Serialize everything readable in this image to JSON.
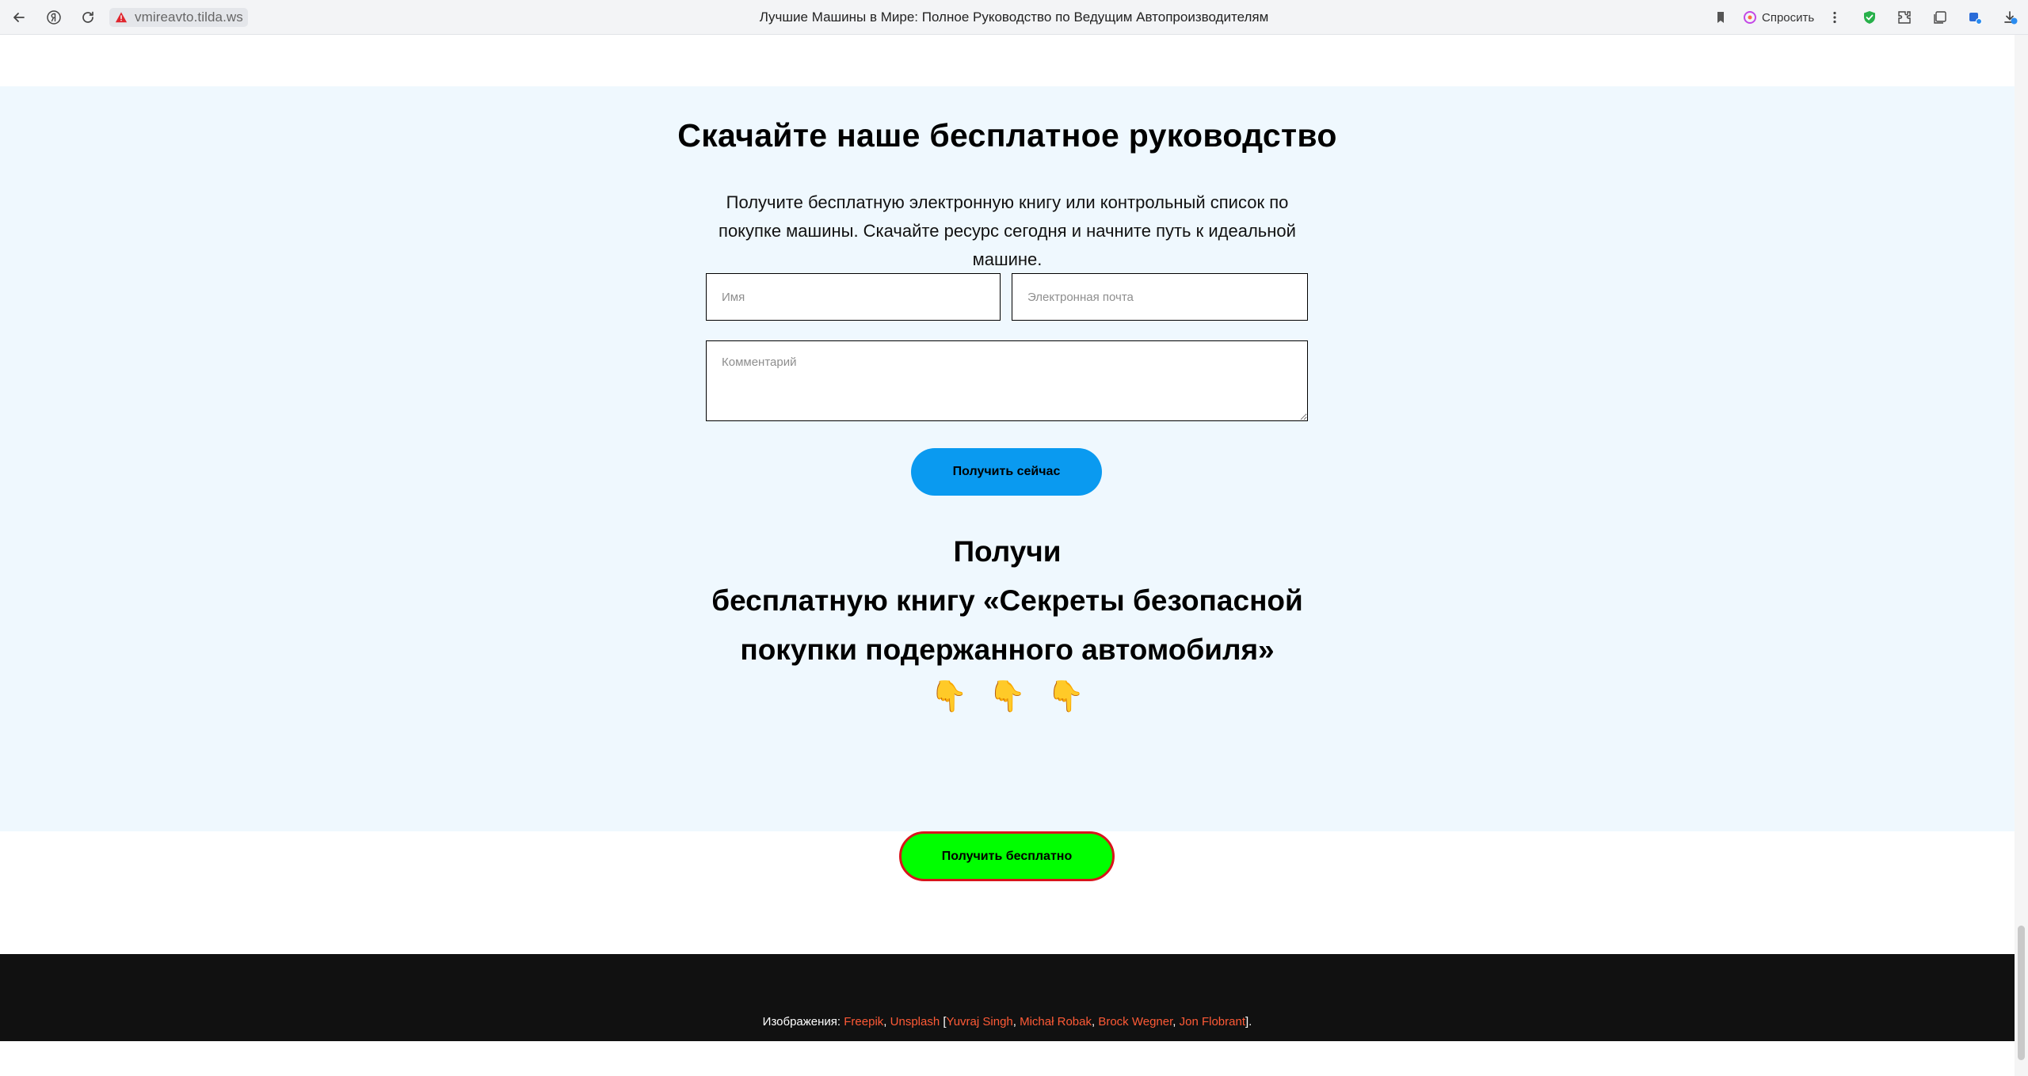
{
  "browser": {
    "url": "vmireavto.tilda.ws",
    "tab_title": "Лучшие Машины в Мире: Полное Руководство по Ведущим Автопроизводителям",
    "ask_label": "Спросить"
  },
  "form_section": {
    "title": "Скачайте наше бесплатное руководство",
    "description": "Получите бесплатную электронную книгу или контрольный список по покупке машины. Скачайте ресурс сегодня и начните путь к идеальной машине.",
    "name_placeholder": "Имя",
    "email_placeholder": "Электронная почта",
    "comment_placeholder": "Комментарий",
    "submit_label": "Получить сейчас"
  },
  "promo": {
    "line1": "Получи",
    "line2": "бесплатную книгу «Секреты безопасной",
    "line3": "покупки подержанного автомобиля»",
    "emojis": [
      "👇",
      "👇",
      "👇"
    ]
  },
  "free_button": {
    "label": "Получить бесплатно"
  },
  "footer": {
    "credits_prefix": "Изображения:",
    "sources": [
      "Freepik",
      "Unsplash"
    ],
    "authors": [
      "Yuvraj Singh",
      "Michał Robak",
      "Brock Wegner",
      "Jon Flobrant"
    ]
  },
  "colors": {
    "section_bg": "#eff8fe",
    "primary_button": "#0a9af0",
    "free_button_bg": "#00ff00",
    "free_button_border": "#d9141c",
    "footer_bg": "#111111",
    "credit_link": "#ff5a36"
  }
}
